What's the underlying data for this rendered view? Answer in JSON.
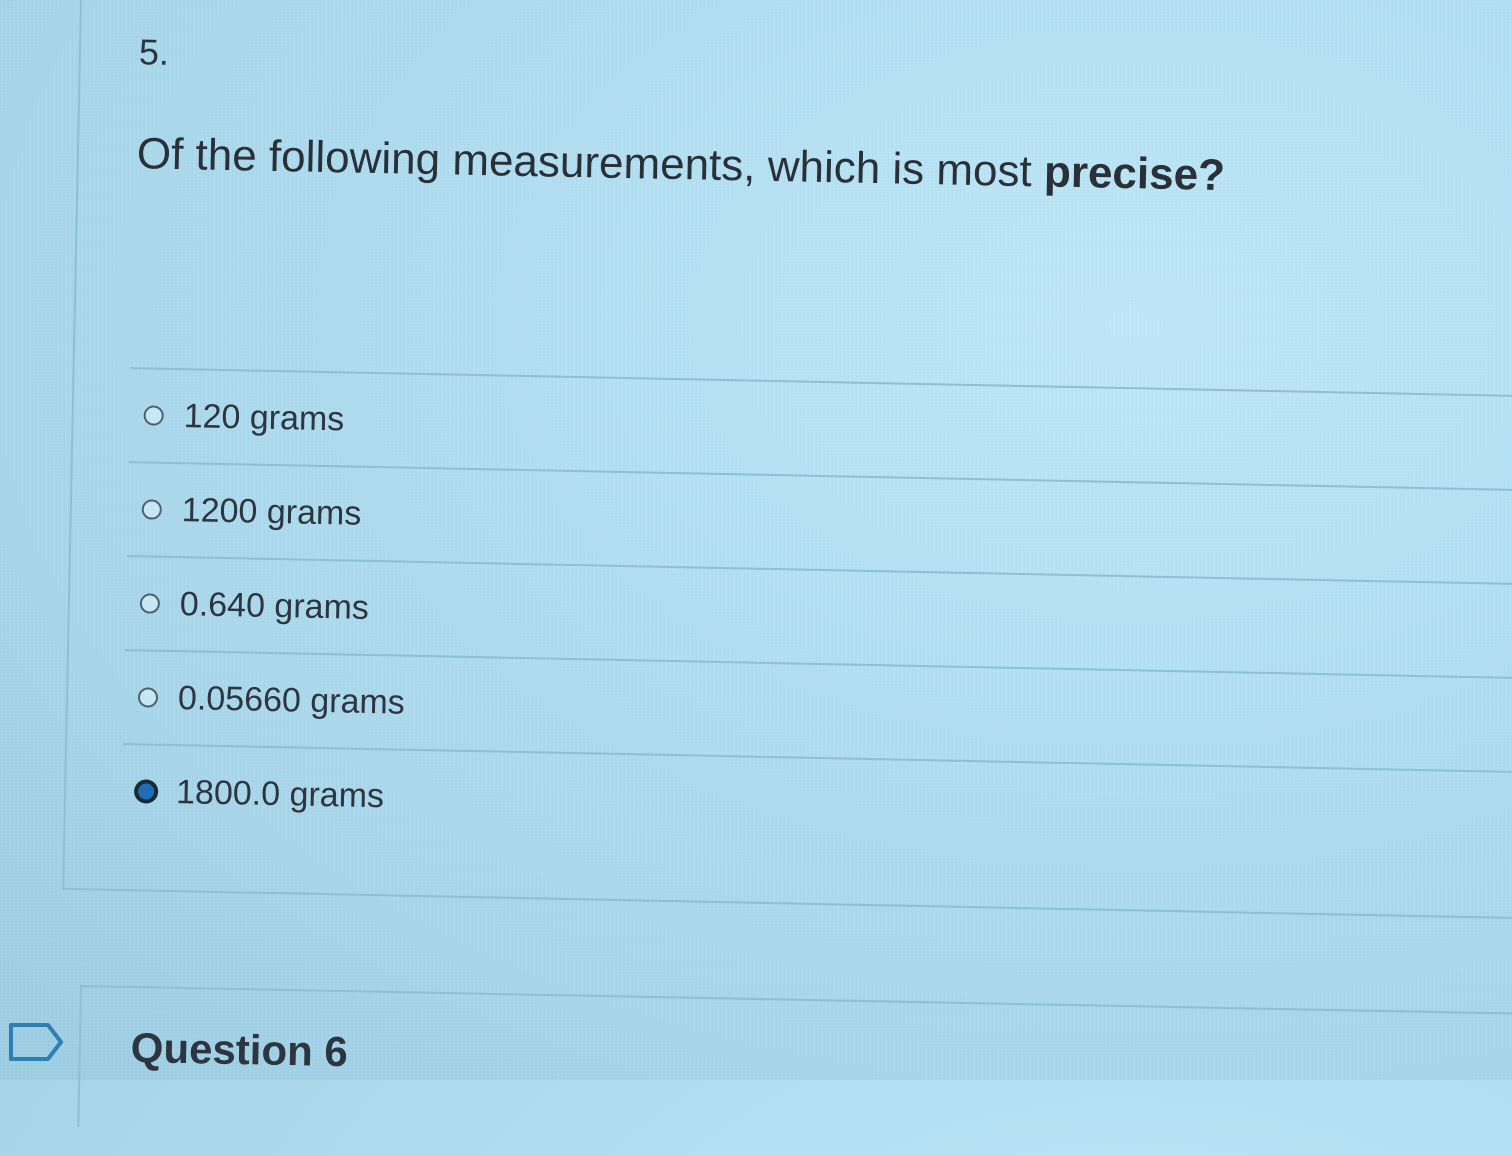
{
  "question": {
    "number": "5.",
    "text": "Of the following measurements, which is most ",
    "emphasis": "precise?",
    "options": [
      {
        "label": "120 grams",
        "selected": false
      },
      {
        "label": "1200 grams",
        "selected": false
      },
      {
        "label": "0.640 grams",
        "selected": false
      },
      {
        "label": "0.05660 grams",
        "selected": false
      },
      {
        "label": "1800.0 grams",
        "selected": true
      }
    ]
  },
  "next_question": {
    "title": "Question 6",
    "flag_icon": "flag-outline-icon"
  },
  "colors": {
    "selected_radio": "#1e6fb8",
    "divider": "#8fbfd2",
    "background": "#b2dff2"
  }
}
